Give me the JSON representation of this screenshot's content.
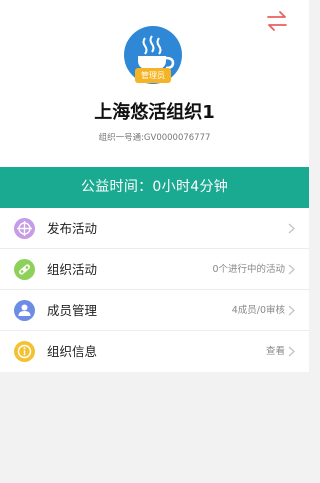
{
  "header": {
    "switch_icon": "switch-arrows-icon",
    "avatar_icon": "coffee-cup-icon",
    "role_badge": "管理员",
    "org_name": "上海悠活组织1",
    "org_id": "组织一号通:GV0000076777"
  },
  "banner": {
    "text": "公益时间：0小时4分钟"
  },
  "menu": {
    "items": [
      {
        "label": "发布活动",
        "value": "",
        "icon": "publish-activity-icon",
        "icon_color": "#c79be8"
      },
      {
        "label": "组织活动",
        "value": "0个进行中的活动",
        "icon": "organize-activity-icon",
        "icon_color": "#8ed15a"
      },
      {
        "label": "成员管理",
        "value": "4成员/0审核",
        "icon": "member-management-icon",
        "icon_color": "#6c8de3"
      },
      {
        "label": "组织信息",
        "value": "查看",
        "icon": "organization-info-icon",
        "icon_color": "#f3c233"
      }
    ]
  },
  "colors": {
    "banner": "#1aaa91",
    "avatar": "#2f88d6",
    "badge": "#f5b425",
    "switch_icon": "#e8615d"
  }
}
